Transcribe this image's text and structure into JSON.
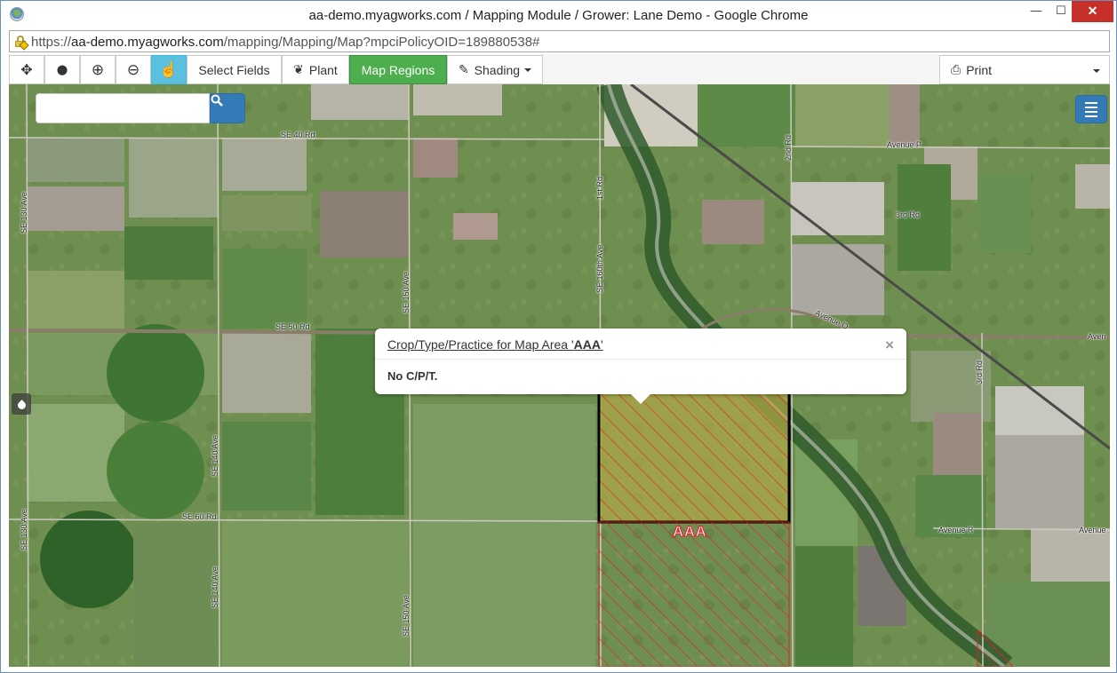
{
  "window": {
    "title": "aa-demo.myagworks.com / Mapping Module / Grower: Lane Demo - Google Chrome",
    "minimize_glyph": "—",
    "maximize_glyph": "☐",
    "close_glyph": "✕"
  },
  "address": {
    "scheme": "https://",
    "host": "aa-demo.myagworks.com",
    "path": "/mapping/Mapping/Map?mpciPolicyOID=189880538#"
  },
  "toolbar": {
    "pan_icon": "✥",
    "pin_icon": "⬤",
    "zoom_in_icon": "⊕",
    "zoom_out_icon": "⊖",
    "select_icon": "☝",
    "select_fields_label": "Select Fields",
    "plant_icon": "❦",
    "plant_label": "Plant",
    "map_regions_label": "Map Regions",
    "shading_icon": "✎",
    "shading_label": "Shading",
    "print_icon": "⎙",
    "print_label": "Print"
  },
  "map": {
    "search_placeholder": "",
    "roads": {
      "se40": "SE 40 Rd",
      "se50": "SE 50 Rd",
      "se60": "SE 60 Rd",
      "se130a": "SE 130 Ave",
      "se130b": "SE 130 Ave",
      "se140a": "SE 140 Ave",
      "se140b": "SE 140 Ave",
      "se150a": "SE 150 Ave",
      "se150b": "SE 150 Ave",
      "first": "1st Rd",
      "se160": "SE 160th Ave",
      "second": "2nd Rd",
      "third": "3rd Rd",
      "third_v": "3rd Rd",
      "avenue_p": "Avenue P",
      "avenue_q": "Avenue Q",
      "avenue_edge": "Aven",
      "avenue_r": "Avenue R",
      "avenue_r2": "Avenue"
    },
    "region_label": "AAA"
  },
  "popup": {
    "title_prefix": "Crop/Type/Practice for Map Area '",
    "title_area": "AAA",
    "title_suffix": "'",
    "close_glyph": "×",
    "body": "No C/P/T."
  },
  "colors": {
    "active_tool": "#5bc0de",
    "map_regions": "#4cae4c",
    "primary": "#337ab7",
    "region_outline": "#e0202a"
  }
}
